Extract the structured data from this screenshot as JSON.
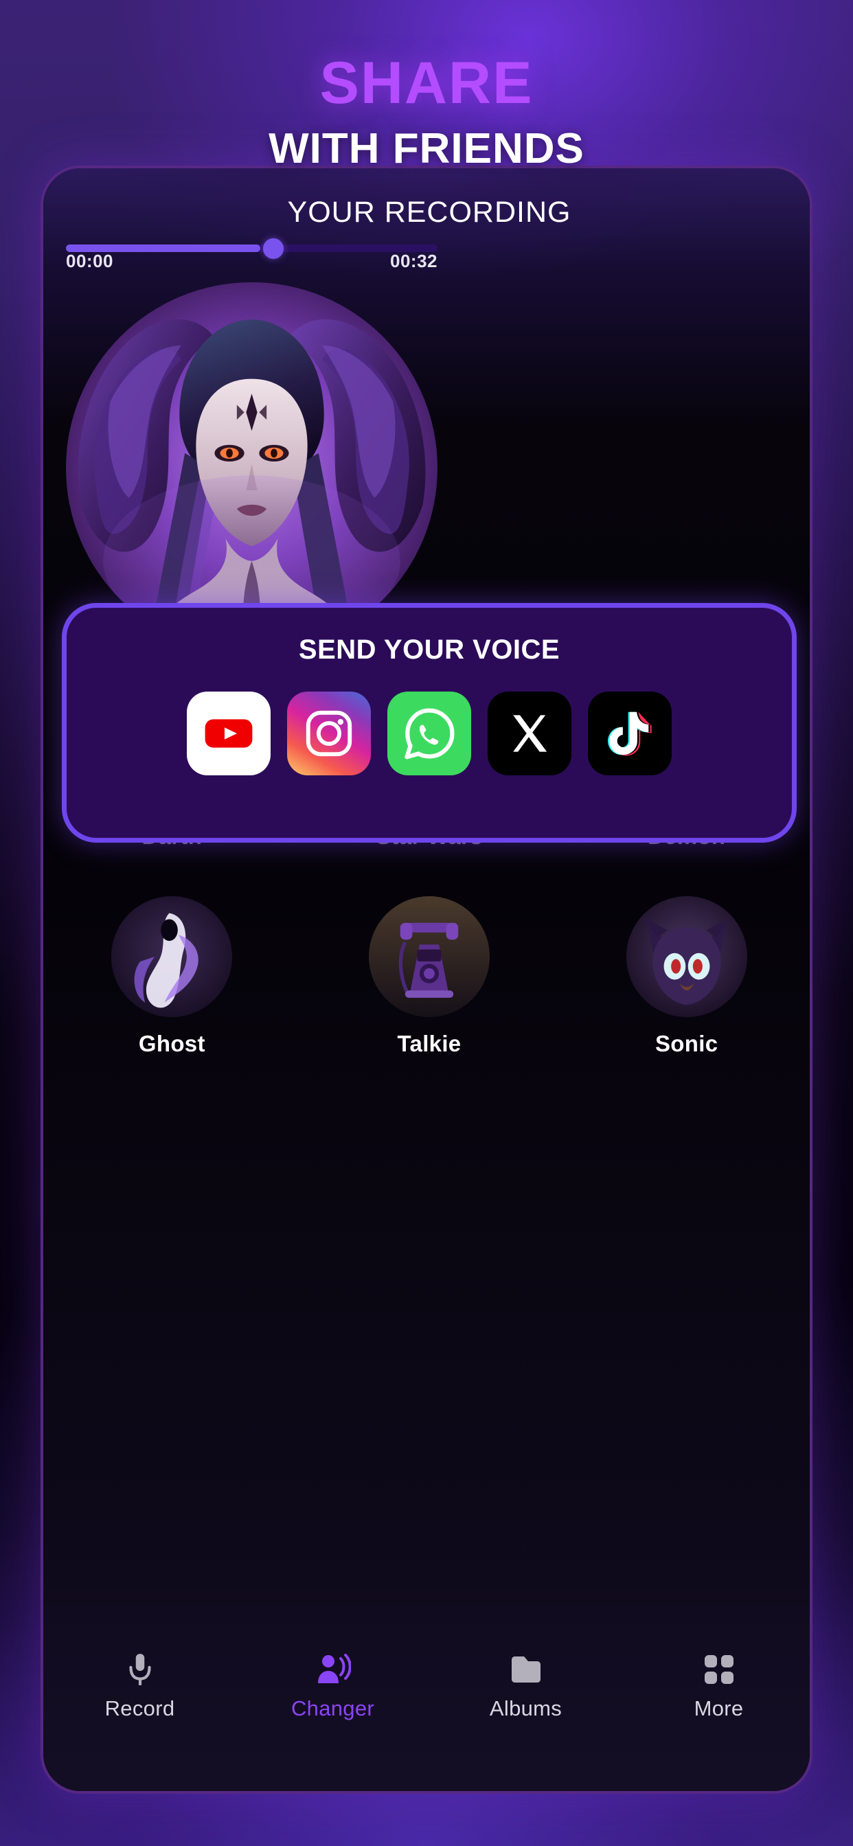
{
  "promo": {
    "headline_line1": "SHARE",
    "headline_line2": "WITH FRIENDS",
    "accent_color": "#b34dff",
    "text_color": "#ffffff"
  },
  "player": {
    "title": "YOUR RECORDING",
    "current_time": "00:00",
    "total_time": "00:32",
    "progress_percent": 52,
    "accent_color": "#7a53ee",
    "track_color": "#2a1062"
  },
  "preview_avatar": {
    "name": "demon-avatar"
  },
  "share": {
    "title": "SEND YOUR VOICE",
    "border_color": "#6f46ec",
    "panel_color": "#2b0b58",
    "targets": [
      {
        "name": "youtube",
        "label": "YouTube",
        "icon": "youtube-icon"
      },
      {
        "name": "instagram",
        "label": "Instagram",
        "icon": "instagram-icon"
      },
      {
        "name": "whatsapp",
        "label": "WhatsApp",
        "icon": "whatsapp-icon"
      },
      {
        "name": "x",
        "label": "X",
        "icon": "x-icon"
      },
      {
        "name": "tiktok",
        "label": "TikTok",
        "icon": "tiktok-icon"
      }
    ]
  },
  "voices": {
    "row1": [
      {
        "label": "Darth",
        "icon": "darth-avatar"
      },
      {
        "label": "Star Wars",
        "icon": "star-wars-avatar"
      },
      {
        "label": "Demon",
        "icon": "demon-avatar"
      }
    ],
    "row2": [
      {
        "label": "Ghost",
        "icon": "ghost-avatar"
      },
      {
        "label": "Talkie",
        "icon": "telephone-avatar"
      },
      {
        "label": "Sonic",
        "icon": "sonic-avatar"
      }
    ]
  },
  "bottom_nav": {
    "active_color": "#8a45f5",
    "inactive_color": "#d9d7e2",
    "items": [
      {
        "label": "Record",
        "icon": "microphone-icon",
        "active": false
      },
      {
        "label": "Changer",
        "icon": "voice-changer-icon",
        "active": true
      },
      {
        "label": "Albums",
        "icon": "folder-icon",
        "active": false
      },
      {
        "label": "More",
        "icon": "grid-icon",
        "active": false
      }
    ]
  }
}
